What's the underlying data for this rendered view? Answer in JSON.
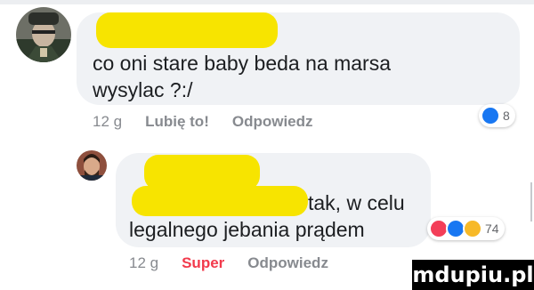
{
  "comments": [
    {
      "text_line1": "co oni stare baby beda na marsa",
      "text_line2": "wysylac ?:/",
      "time": "12 g",
      "like_label": "Lubię to!",
      "reply_label": "Odpowiedz",
      "reaction_count": "8",
      "reactions": [
        "like-icon"
      ]
    },
    {
      "text_line1": "tak, w celu",
      "text_line2": "legalnego jebania prądem",
      "time": "12 g",
      "like_label": "Super",
      "reply_label": "Odpowiedz",
      "reaction_count": "74",
      "reactions": [
        "love-icon",
        "like-icon",
        "haha-icon"
      ]
    }
  ],
  "colors": {
    "bubble": "#f0f2f5",
    "redaction": "#f7e400",
    "meta_text": "#878a8f",
    "super_label": "#f23a4c",
    "like_blue": "#1877f2",
    "love_red": "#f33e58",
    "haha_yellow": "#f7b928"
  },
  "watermark": "mdupiu.pl"
}
